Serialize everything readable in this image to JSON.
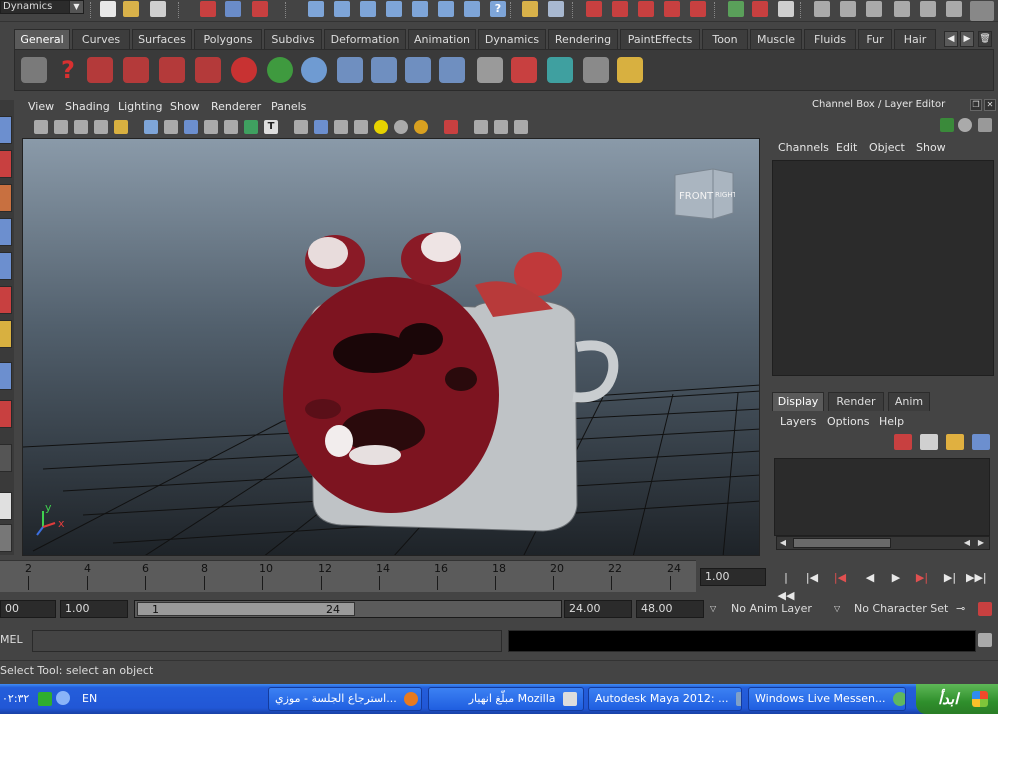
{
  "statusline": {
    "menu_set": "Dynamics"
  },
  "shelf": {
    "tabs": [
      "General",
      "Curves",
      "Surfaces",
      "Polygons",
      "Subdivs",
      "Deformation",
      "Animation",
      "Dynamics",
      "Rendering",
      "PaintEffects",
      "Toon",
      "Muscle",
      "Fluids",
      "Fur",
      "Hair"
    ],
    "active_tab": "General"
  },
  "panel": {
    "menus": [
      "View",
      "Shading",
      "Lighting",
      "Show",
      "Renderer",
      "Panels"
    ],
    "viewcube": {
      "front": "FRONT",
      "right": "RIGHT"
    },
    "axis": {
      "x": "x",
      "y": "y"
    }
  },
  "channel_box": {
    "title": "Channel Box / Layer Editor",
    "menus": [
      "Channels",
      "Edit",
      "Object",
      "Show"
    ]
  },
  "layer_editor": {
    "tabs": [
      "Display",
      "Render",
      "Anim"
    ],
    "active_tab": "Display",
    "menus": [
      "Layers",
      "Options",
      "Help"
    ]
  },
  "time_slider": {
    "ticks": [
      "2",
      "4",
      "6",
      "8",
      "10",
      "12",
      "14",
      "16",
      "18",
      "20",
      "22",
      "24"
    ],
    "current_time": "1.00"
  },
  "range_slider": {
    "anim_start": "00",
    "range_start": "1.00",
    "thumb_start": "1",
    "thumb_end": "24",
    "range_end": "24.00",
    "anim_end": "48.00",
    "anim_layer": "No Anim Layer",
    "character_set": "No Character Set"
  },
  "command_line": {
    "label": "MEL"
  },
  "help_line": {
    "text": "Select Tool: select an object"
  },
  "taskbar": {
    "start_label": "ابدأ",
    "tasks": [
      "Windows Live Messen...",
      "Autodesk Maya 2012: ...",
      "مبلّغ انهيار Mozilla",
      "استرجاع الجلسة - موزي..."
    ],
    "language": "EN",
    "clock": "٠٢:٣٢"
  },
  "colors": {
    "app_bg": "#444444",
    "taskbar_blue": "#245edb",
    "start_green": "#3a9a35",
    "viewport_top": "#8a9aa9",
    "viewport_bottom": "#1e2328",
    "model_red": "#7d1420"
  }
}
